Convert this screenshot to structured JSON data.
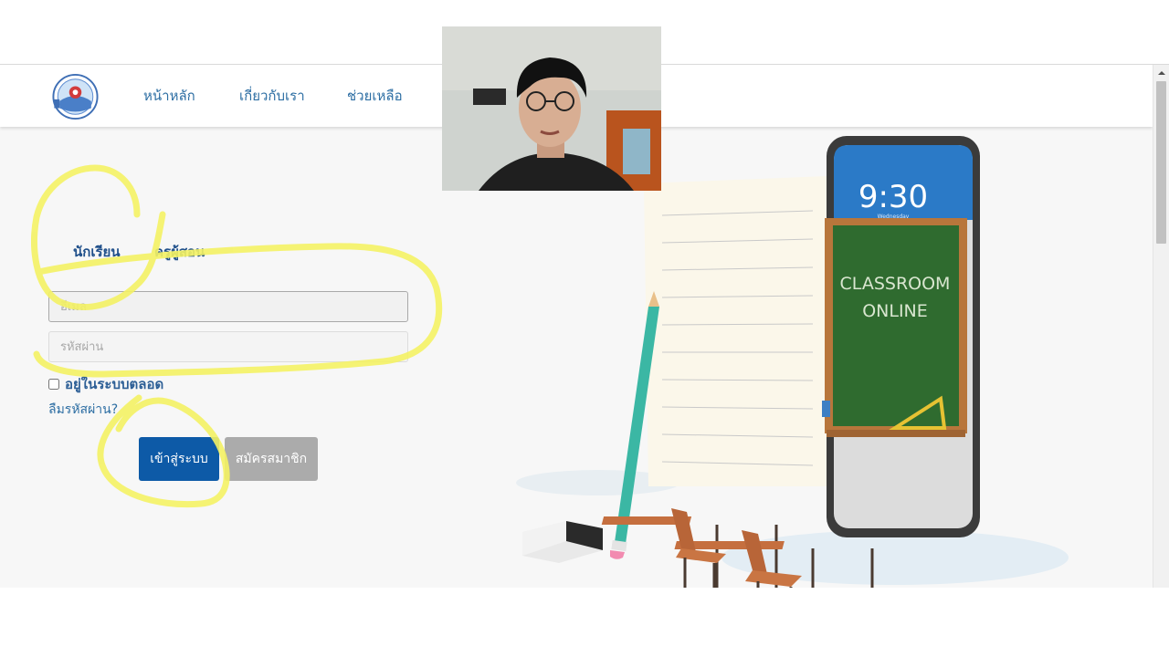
{
  "nav": {
    "items": [
      {
        "label": "หน้าหลัก"
      },
      {
        "label": "เกี่ยวกับเรา"
      },
      {
        "label": "ช่วยเหลือ"
      }
    ]
  },
  "login": {
    "tabs": [
      {
        "label": "นักเรียน"
      },
      {
        "label": "ครูผู้สอน"
      }
    ],
    "email_placeholder": "อีเมล",
    "password_placeholder": "รหัสผ่าน",
    "remember_label": "อยู่ในระบบตลอด",
    "forgot_label": "ลืมรหัสผ่าน?",
    "login_button": "เข้าสู่ระบบ",
    "register_button": "สมัครสมาชิก"
  },
  "illustration": {
    "phone_time": "9:30",
    "phone_day": "Wednesday",
    "board_line1": "CLASSROOM",
    "board_line2": "ONLINE"
  },
  "colors": {
    "accent": "#0d5aa7",
    "nav_link": "#2d6ea3",
    "highlight": "#f4f264",
    "board": "#2f6b2f"
  }
}
